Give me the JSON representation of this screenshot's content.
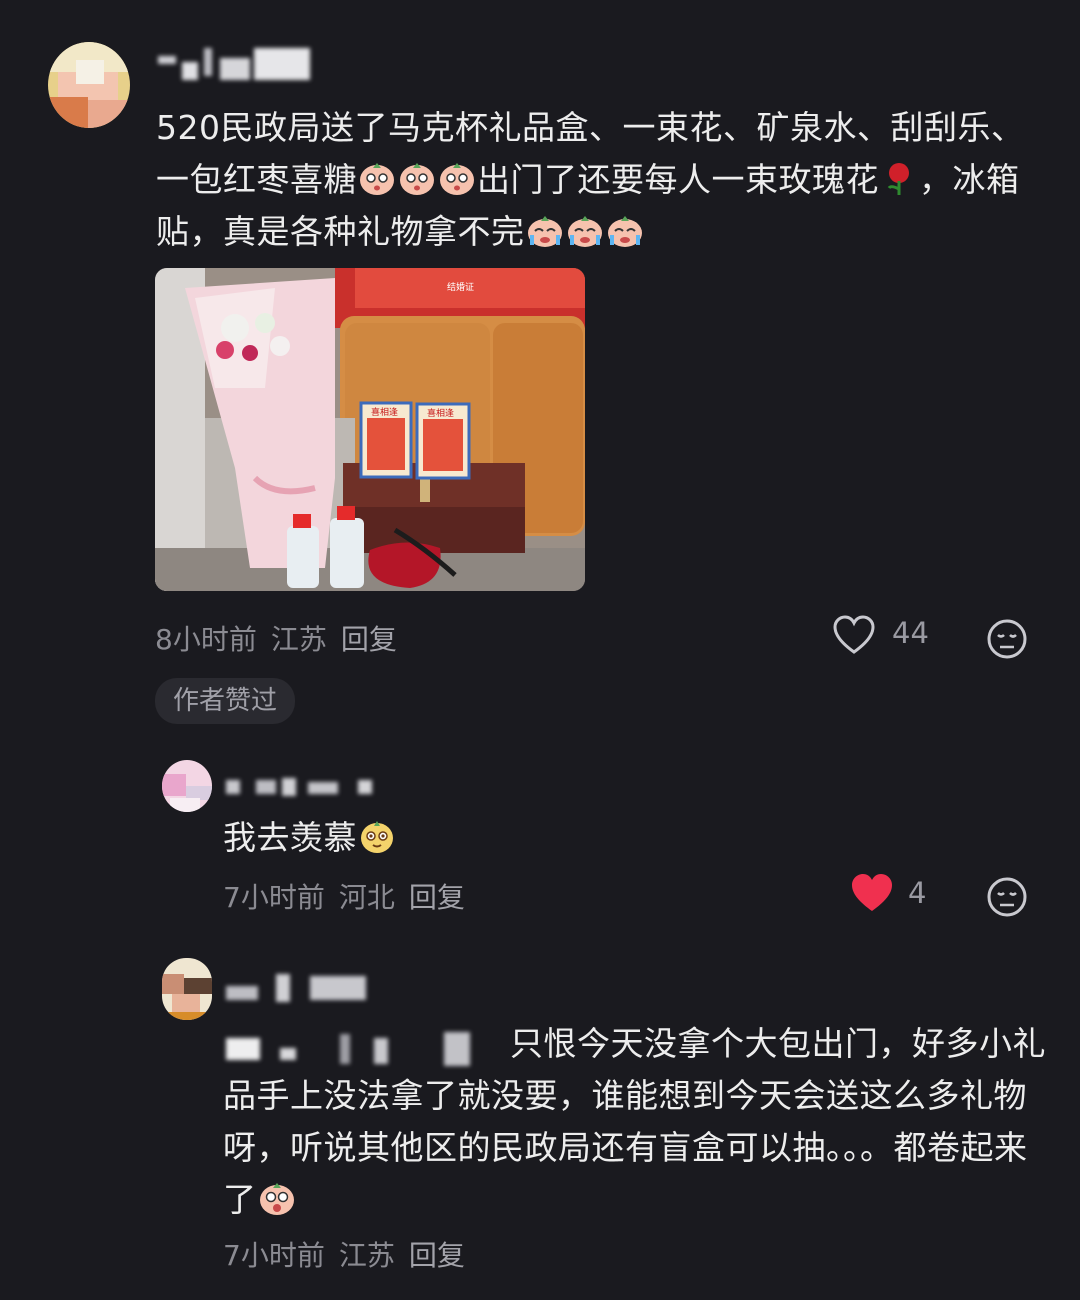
{
  "comment1": {
    "text": "520民政局送了马克杯礼品盒、一束花、矿泉水、刮刮乐、一包红枣喜糖",
    "text_mid": "出门了还要每人一束玫瑰花",
    "text_end": "，冰箱贴，真是各种礼物拿不完",
    "time": "8小时前",
    "location": "江苏",
    "reply": "回复",
    "likes": "44",
    "author_badge": "作者赞过",
    "photo_labels": [
      "结婚证",
      "喜相逢",
      "喜相逢"
    ]
  },
  "comment2": {
    "text": "我去羡慕",
    "time": "7小时前",
    "location": "河北",
    "reply": "回复",
    "likes": "4",
    "liked": true
  },
  "comment3": {
    "text": "只恨今天没拿个大包出门，好多小礼品手上没法拿了就没要，谁能想到今天会送这么多礼物呀，听说其他区的民政局还有盲盒可以抽。。。都卷起来了",
    "time": "7小时前",
    "location": "江苏",
    "reply": "回复"
  },
  "colors": {
    "background": "#1a1a1f",
    "like_red": "#f0304f",
    "meta_gray": "#8b8b92"
  }
}
